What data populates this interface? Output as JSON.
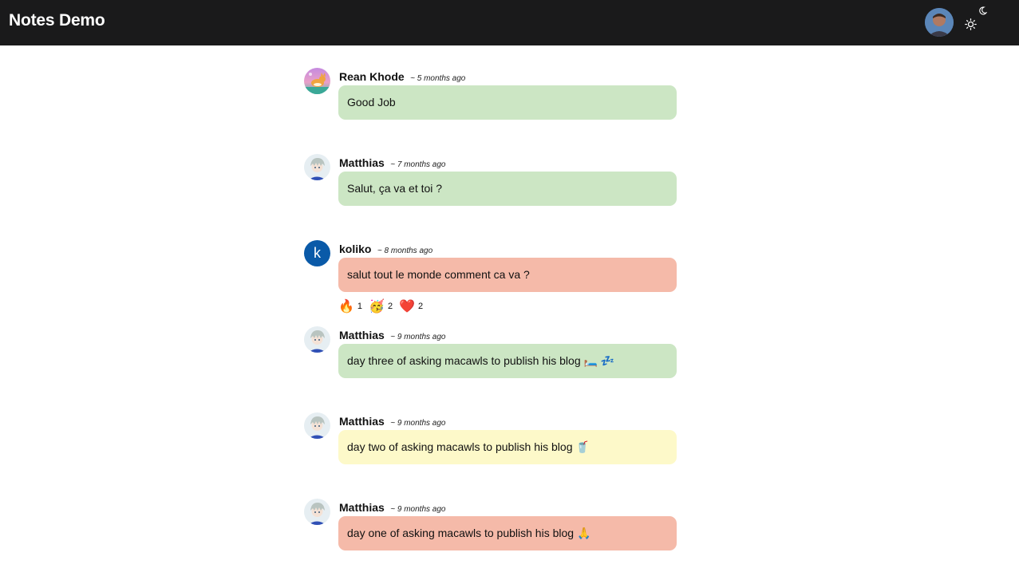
{
  "app": {
    "title": "Notes Demo"
  },
  "header": {
    "user_avatar_icon": "user-avatar-photo",
    "theme_icons": [
      "moon-icon",
      "sun-icon"
    ]
  },
  "notes": [
    {
      "author": "Rean Khode",
      "time": "~ 5 months ago",
      "text": "Good Job",
      "color": "#cce6c4",
      "avatar": "corgi-avatar"
    },
    {
      "author": "Matthias",
      "time": "~ 7 months ago",
      "text": "Salut, ça va et toi ?",
      "color": "#cce6c4",
      "avatar": "anime-avatar"
    },
    {
      "author": "koliko",
      "time": "~ 8 months ago",
      "text": "salut tout le monde comment ca va ?",
      "color": "#f5baa9",
      "avatar_letter": "k",
      "reactions": [
        {
          "emoji": "🔥",
          "count": "1"
        },
        {
          "emoji": "🥳",
          "count": "2"
        },
        {
          "emoji": "❤️",
          "count": "2"
        }
      ]
    },
    {
      "author": "Matthias",
      "time": "~ 9 months ago",
      "text": "day three of asking macawls to publish his blog 🛏️ 💤",
      "color": "#cce6c4",
      "avatar": "anime-avatar"
    },
    {
      "author": "Matthias",
      "time": "~ 9 months ago",
      "text": "day two of asking macawls to publish his blog 🥤",
      "color": "#fdf9c9",
      "avatar": "anime-avatar"
    },
    {
      "author": "Matthias",
      "time": "~ 9 months ago",
      "text": "day one of asking macawls to publish his blog 🙏",
      "color": "#f5baa9",
      "avatar": "anime-avatar"
    }
  ]
}
